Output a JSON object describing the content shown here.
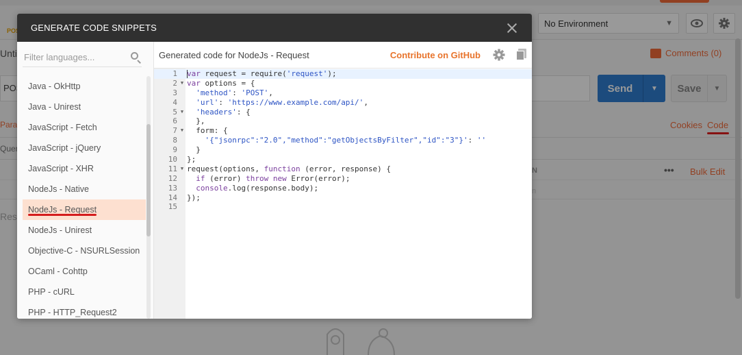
{
  "background": {
    "method_tag": "POS",
    "tab_title": "Untit",
    "environment": "No Environment",
    "comments": "Comments (0)",
    "url_method": "POS",
    "send_label": "Send",
    "save_label": "Save",
    "params_tab": "Para",
    "cookies_link": "Cookies",
    "code_link": "Code",
    "query_label": "Quer",
    "column_header": "N",
    "more_dots": "•••",
    "bulk_edit": "Bulk Edit",
    "column_placeholder": "n",
    "response_label": "Resp"
  },
  "modal": {
    "title": "GENERATE CODE SNIPPETS",
    "search_placeholder": "Filter languages...",
    "languages": [
      "Java - OkHttp",
      "Java - Unirest",
      "JavaScript - Fetch",
      "JavaScript - jQuery",
      "JavaScript - XHR",
      "NodeJs - Native",
      "NodeJs - Request",
      "NodeJs - Unirest",
      "Objective-C - NSURLSession",
      "OCaml - Cohttp",
      "PHP - cURL",
      "PHP - HTTP_Request2"
    ],
    "selected_language": "NodeJs - Request",
    "code_header": "Generated code for NodeJs - Request",
    "github_link": "Contribute on GitHub"
  },
  "colors": {
    "accent": "#f26b3a",
    "send_button": "#2f7dd0",
    "modal_header": "#303030",
    "selected_row": "#fde0d0",
    "annotation_red": "#d41c1c"
  },
  "icons": [
    "close-icon",
    "search-icon",
    "gear-icon",
    "copy-icon",
    "eye-icon",
    "chevron-down-icon"
  ]
}
